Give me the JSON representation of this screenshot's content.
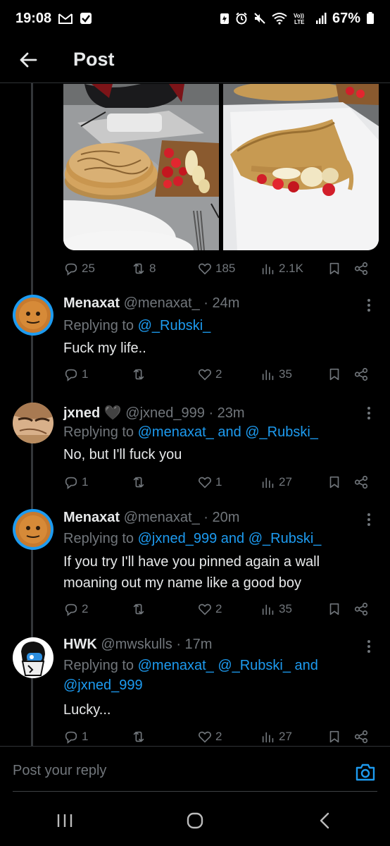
{
  "status_bar": {
    "time": "19:08",
    "battery": "67%",
    "icons": [
      "gmail-icon",
      "check-icon",
      "battery-saver-icon",
      "alarm-icon",
      "mute-icon",
      "wifi-icon",
      "volte-icon",
      "signal-icon",
      "battery-icon"
    ]
  },
  "header": {
    "title": "Post",
    "back_icon": "arrow-left-icon"
  },
  "original_post": {
    "media": [
      "pancakes-plate-photo",
      "crepe-with-fruit-photo"
    ],
    "actions": {
      "replies": "25",
      "reposts": "8",
      "likes": "185",
      "views": "2.1K"
    }
  },
  "replies": [
    {
      "name": "Menaxat",
      "handle": "@menaxat_",
      "time": "· 24m",
      "replying_prefix": "Replying to ",
      "mentions": "@_Rubski_",
      "text": [
        "Fuck my life.."
      ],
      "actions": {
        "replies": "1",
        "reposts": "",
        "likes": "2",
        "views": "35"
      }
    },
    {
      "name": "jxned",
      "badge": "🖤",
      "handle": "@jxned_999",
      "time": "· 23m",
      "replying_prefix": "Replying to ",
      "mentions": "@menaxat_ and @_Rubski_",
      "text": [
        "No, but I'll fuck you"
      ],
      "actions": {
        "replies": "1",
        "reposts": "",
        "likes": "1",
        "views": "27"
      }
    },
    {
      "name": "Menaxat",
      "handle": "@menaxat_",
      "time": "· 20m",
      "replying_prefix": "Replying to ",
      "mentions": "@jxned_999 and @_Rubski_",
      "text": [
        "If you try I'll have you pinned again a wall",
        "moaning out my name like a good boy"
      ],
      "actions": {
        "replies": "2",
        "reposts": "",
        "likes": "2",
        "views": "35"
      }
    },
    {
      "name": "HWK",
      "handle": "@mwskulls",
      "time": "· 17m",
      "replying_prefix": "Replying to ",
      "mentions": "@menaxat_ @_Rubski_ and",
      "mentions_line2": "@jxned_999",
      "text": [
        "Lucky..."
      ],
      "actions": {
        "replies": "1",
        "reposts": "",
        "likes": "2",
        "views": "27"
      }
    }
  ],
  "composer": {
    "placeholder": "Post your reply",
    "camera_icon": "camera-icon"
  },
  "navbar": {
    "icons": [
      "recent-apps-icon",
      "home-icon",
      "back-icon"
    ]
  },
  "colors": {
    "background": "#000000",
    "text": "#e7e9ea",
    "muted": "#71767b",
    "accent": "#1d9bf0",
    "divider": "#2f3336"
  }
}
